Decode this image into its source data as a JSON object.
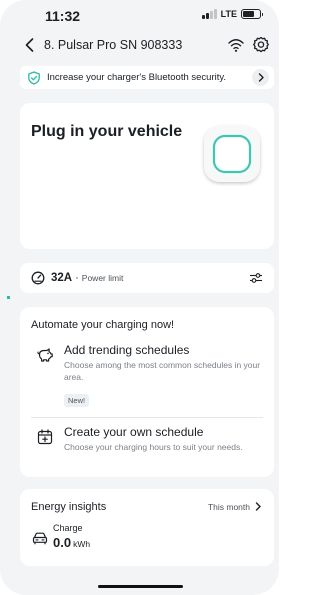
{
  "status_bar": {
    "time": "11:32",
    "network": "LTE",
    "signal_bars": 2,
    "battery_level": 0.7
  },
  "header": {
    "title": "8. Pulsar Pro SN 908333"
  },
  "banner": {
    "text": "Increase your charger's Bluetooth security."
  },
  "plug": {
    "title": "Plug in your vehicle"
  },
  "power": {
    "amps": "32A",
    "separator": "·",
    "label": "Power limit"
  },
  "automate": {
    "title": "Automate your charging now!",
    "items": [
      {
        "title": "Add trending schedules",
        "description": "Choose among the most common schedules in your area.",
        "badge": "New!"
      },
      {
        "title": "Create your own schedule",
        "description": "Choose your charging hours to suit your needs."
      }
    ]
  },
  "energy": {
    "title": "Energy insights",
    "period": "This month",
    "charge_label": "Charge",
    "charge_value": "0.0",
    "charge_unit": "kWh"
  },
  "colors": {
    "accent": "#2bb9a8",
    "background": "#f3f4f5",
    "card": "#ffffff"
  },
  "icons": [
    "signal-icon",
    "battery-icon",
    "back-chevron-icon",
    "wifi-icon",
    "gear-icon",
    "shield-check-icon",
    "chevron-right-icon",
    "charger-icon",
    "gauge-icon",
    "sliders-icon",
    "piggy-bank-icon",
    "calendar-plus-icon",
    "car-icon"
  ]
}
